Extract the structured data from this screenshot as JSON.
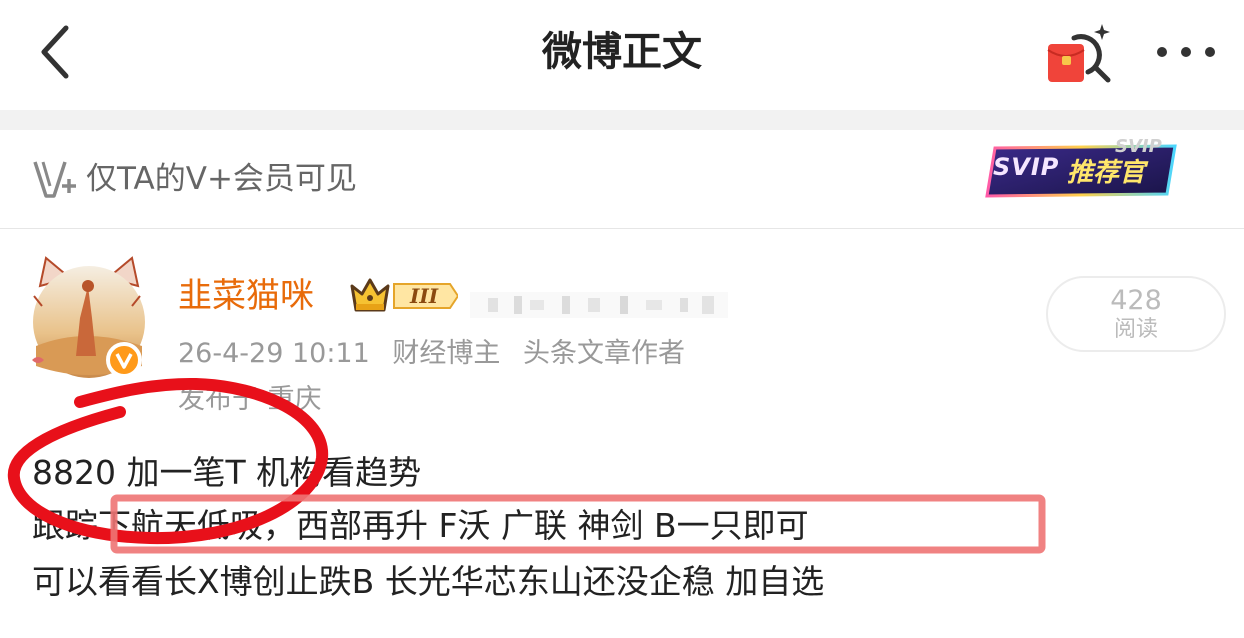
{
  "header": {
    "title": "微博正文",
    "back_icon": "chevron-left-icon",
    "redpacket_icon": "red-packet-search-icon",
    "more_icon": "more-dots-icon"
  },
  "membership": {
    "icon": "v-plus-icon",
    "text": "仅TA的V+会员可见",
    "badge_text": "SVIP",
    "badge_text_zh": "推荐官",
    "badge_watermark": "SVIP"
  },
  "post": {
    "author": "韭菜猫咪",
    "crown_level": "III",
    "timestamp": "26-4-29 10:11",
    "tags": [
      "财经博主",
      "头条文章作者"
    ],
    "location": "发布于 重庆",
    "reads_count": "428",
    "reads_label": "阅读",
    "lines": [
      "8820  加一笔T 机构看趋势",
      "跟踪下航天低吸，西部再升 F沃 广联 神剑 B一只即可",
      "可以看看长X博创止跌B 长光华芯东山还没企稳 加自选"
    ]
  },
  "colors": {
    "username": "#e86b0a",
    "annotation_red": "#e8101a",
    "highlight_box": "#ee7474",
    "meta_gray": "#999999"
  }
}
